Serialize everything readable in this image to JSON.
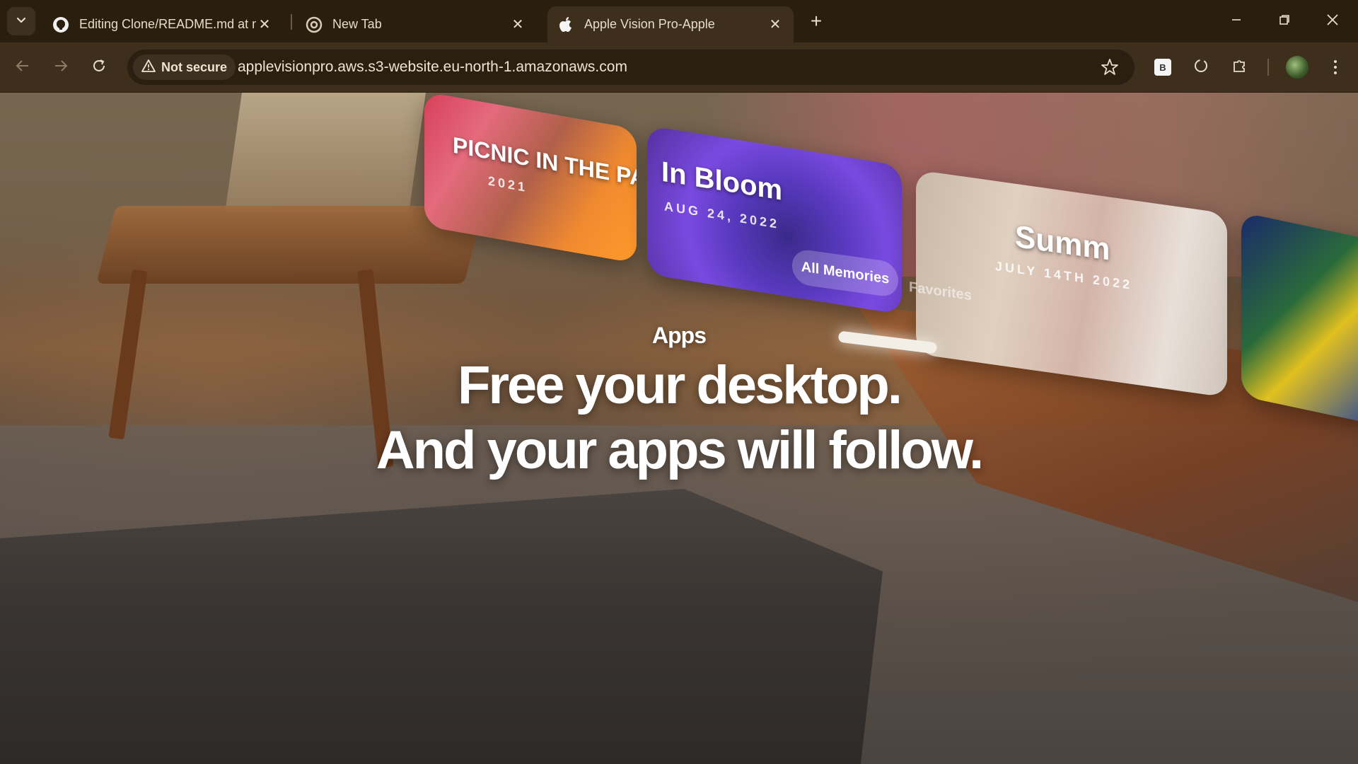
{
  "browser": {
    "tabs": [
      {
        "title": "Editing Clone/README.md at m",
        "favicon": "github-icon",
        "active": false
      },
      {
        "title": "New Tab",
        "favicon": "chrome-icon",
        "active": false
      },
      {
        "title": "Apple Vision Pro-Apple",
        "favicon": "apple-icon",
        "active": true
      }
    ],
    "security_label": "Not secure",
    "url": "applevisionpro.aws.s3-website.eu-north-1.amazonaws.com",
    "extension_b_label": "B"
  },
  "page": {
    "panels": [
      {
        "title": "PICNIC IN THE PARK",
        "date": "2021"
      },
      {
        "title": "In Bloom",
        "date": "AUG 24, 2022"
      },
      {
        "title": "Summ",
        "date": "JULY 14TH 2022"
      }
    ],
    "pill_label": "All Memories",
    "favorites_label": "Favorites",
    "eyebrow": "Apps",
    "headline_line1": "Free your desktop.",
    "headline_line2": "And your apps will follow."
  }
}
